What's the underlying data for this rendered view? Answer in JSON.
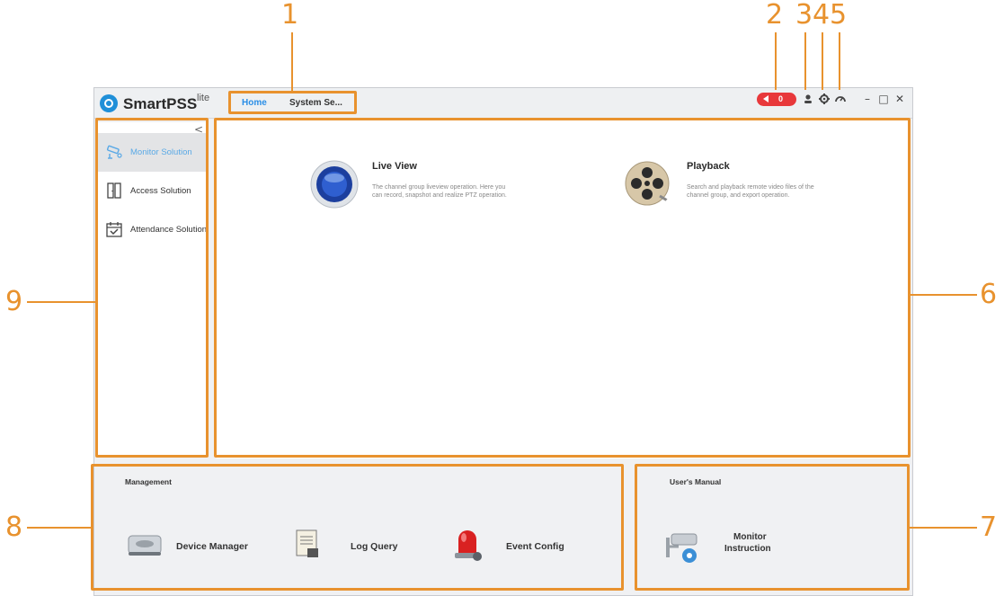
{
  "app": {
    "name": "SmartPSS",
    "name_sup": "lite"
  },
  "tabs": [
    {
      "label": "Home",
      "active": true
    },
    {
      "label": "System Se...",
      "active": false
    }
  ],
  "toolbar": {
    "alarm_count": "0",
    "user_icon": "user-icon",
    "settings_icon": "gear-icon",
    "dashboard_icon": "gauge-icon",
    "minimize": "–",
    "maximize": "□",
    "close": "✕"
  },
  "sidebar": {
    "collapse": "<",
    "items": [
      {
        "label": "Monitor Solution",
        "icon": "cctv-camera-icon",
        "active": true
      },
      {
        "label": "Access Solution",
        "icon": "door-icon",
        "active": false
      },
      {
        "label": "Attendance Solution",
        "icon": "calendar-check-icon",
        "active": false
      }
    ]
  },
  "main": {
    "features": [
      {
        "title": "Live View",
        "description": "The channel group liveview operation. Here you can record, snapshot and realize PTZ operation.",
        "icon": "live-view-icon"
      },
      {
        "title": "Playback",
        "description": "Search and playback remote video files of the channel group, and export operation.",
        "icon": "film-reel-icon"
      }
    ]
  },
  "management": {
    "title": "Management",
    "tools": [
      {
        "label": "Device Manager",
        "icon": "device-manager-icon"
      },
      {
        "label": "Log Query",
        "icon": "log-query-icon"
      },
      {
        "label": "Event Config",
        "icon": "alarm-light-icon"
      }
    ]
  },
  "manual": {
    "title": "User's Manual",
    "item_label_line1": "Monitor",
    "item_label_line2": "Instruction",
    "icon": "camera-instruction-icon"
  },
  "callouts": {
    "n1": "1",
    "n2": "2",
    "n3": "3",
    "n4": "4",
    "n5": "5",
    "n6": "6",
    "n7": "7",
    "n8": "8",
    "n9": "9"
  },
  "colors": {
    "callout": "#e8922e",
    "accent": "#2a8ee6",
    "alarm": "#e8383b"
  }
}
